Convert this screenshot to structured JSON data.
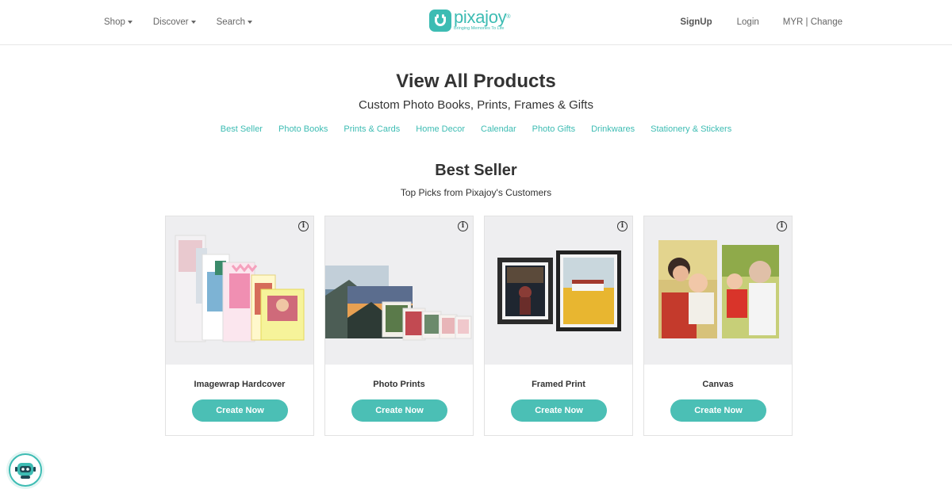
{
  "header": {
    "nav_left": [
      {
        "label": "Shop"
      },
      {
        "label": "Discover"
      },
      {
        "label": "Search"
      }
    ],
    "logo": {
      "name": "pixajoy",
      "reg": "®",
      "tagline": "Bringing Memories To Life"
    },
    "signup": "SignUp",
    "login": "Login",
    "currency": "MYR | Change"
  },
  "hero": {
    "title": "View All Products",
    "subtitle": "Custom Photo Books, Prints, Frames & Gifts",
    "categories": [
      "Best Seller",
      "Photo Books",
      "Prints & Cards",
      "Home Decor",
      "Calendar",
      "Photo Gifts",
      "Drinkwares",
      "Stationery & Stickers"
    ]
  },
  "section": {
    "title": "Best Seller",
    "subtitle": "Top Picks from Pixajoy's Customers"
  },
  "products": [
    {
      "name": "Imagewrap Hardcover",
      "button": "Create Now",
      "info": "i"
    },
    {
      "name": "Photo Prints",
      "button": "Create Now",
      "info": "i"
    },
    {
      "name": "Framed Print",
      "button": "Create Now",
      "info": "i"
    },
    {
      "name": "Canvas",
      "button": "Create Now",
      "info": "i"
    }
  ],
  "colors": {
    "accent": "#3dbcb3",
    "button": "#4bbfb5"
  },
  "chat_widget": {
    "icon": "robot-chat-icon"
  }
}
